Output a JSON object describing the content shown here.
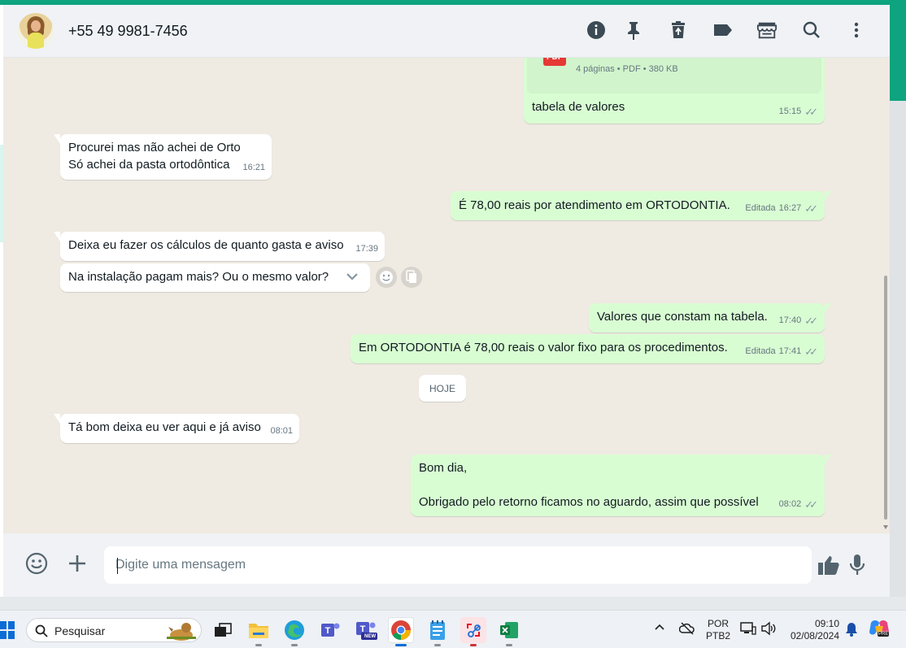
{
  "header": {
    "contact_name": "+55 49 9981-7456"
  },
  "messages": [
    {
      "id": "m1",
      "direction": "out",
      "pdf_label": "PDF",
      "pdf_meta": "4 páginas • PDF • 380 KB",
      "text": "tabela de valores",
      "time": "15:15"
    },
    {
      "id": "m2",
      "direction": "in",
      "text": "Procurei mas não achei de Orto\nSó achei da pasta ortodôntica",
      "time": "16:21"
    },
    {
      "id": "m3",
      "direction": "out",
      "text": "É 78,00 reais por atendimento em ORTODONTIA.",
      "edited": "Editada",
      "time": "16:27"
    },
    {
      "id": "m4",
      "direction": "in",
      "text": "Deixa eu fazer os cálculos de quanto gasta e aviso",
      "time": "17:39"
    },
    {
      "id": "m5",
      "direction": "in",
      "text": "Na instalação pagam mais? Ou o mesmo valor?",
      "time": ""
    },
    {
      "id": "m6",
      "direction": "out",
      "text": "Valores que constam na tabela.",
      "time": "17:40"
    },
    {
      "id": "m7",
      "direction": "out",
      "text": "Em ORTODONTIA é 78,00 reais o valor fixo para os procedimentos.",
      "edited": "Editada",
      "time": "17:41"
    },
    {
      "id": "m8",
      "direction": "in",
      "text": "Tá bom deixa eu ver aqui e já aviso",
      "time": "08:01"
    },
    {
      "id": "m9",
      "direction": "out",
      "text": "Bom dia,\n\nObrigado pelo retorno ficamos no aguardo, assim que possível",
      "time": "08:02"
    }
  ],
  "day_divider": "HOJE",
  "composer": {
    "placeholder": "Digite uma mensagem"
  },
  "taskbar": {
    "search_label": "Pesquisar",
    "lang_top": "POR",
    "lang_bottom": "PTB2",
    "clock_time": "09:10",
    "clock_date": "02/08/2024",
    "copilot_badge": "PRE",
    "teams_badge": "NEW"
  },
  "colors": {
    "accent_green": "#0da47f",
    "outgoing_bubble": "#d9fdd3",
    "incoming_bubble": "#ffffff",
    "chat_background": "#efeae2"
  }
}
